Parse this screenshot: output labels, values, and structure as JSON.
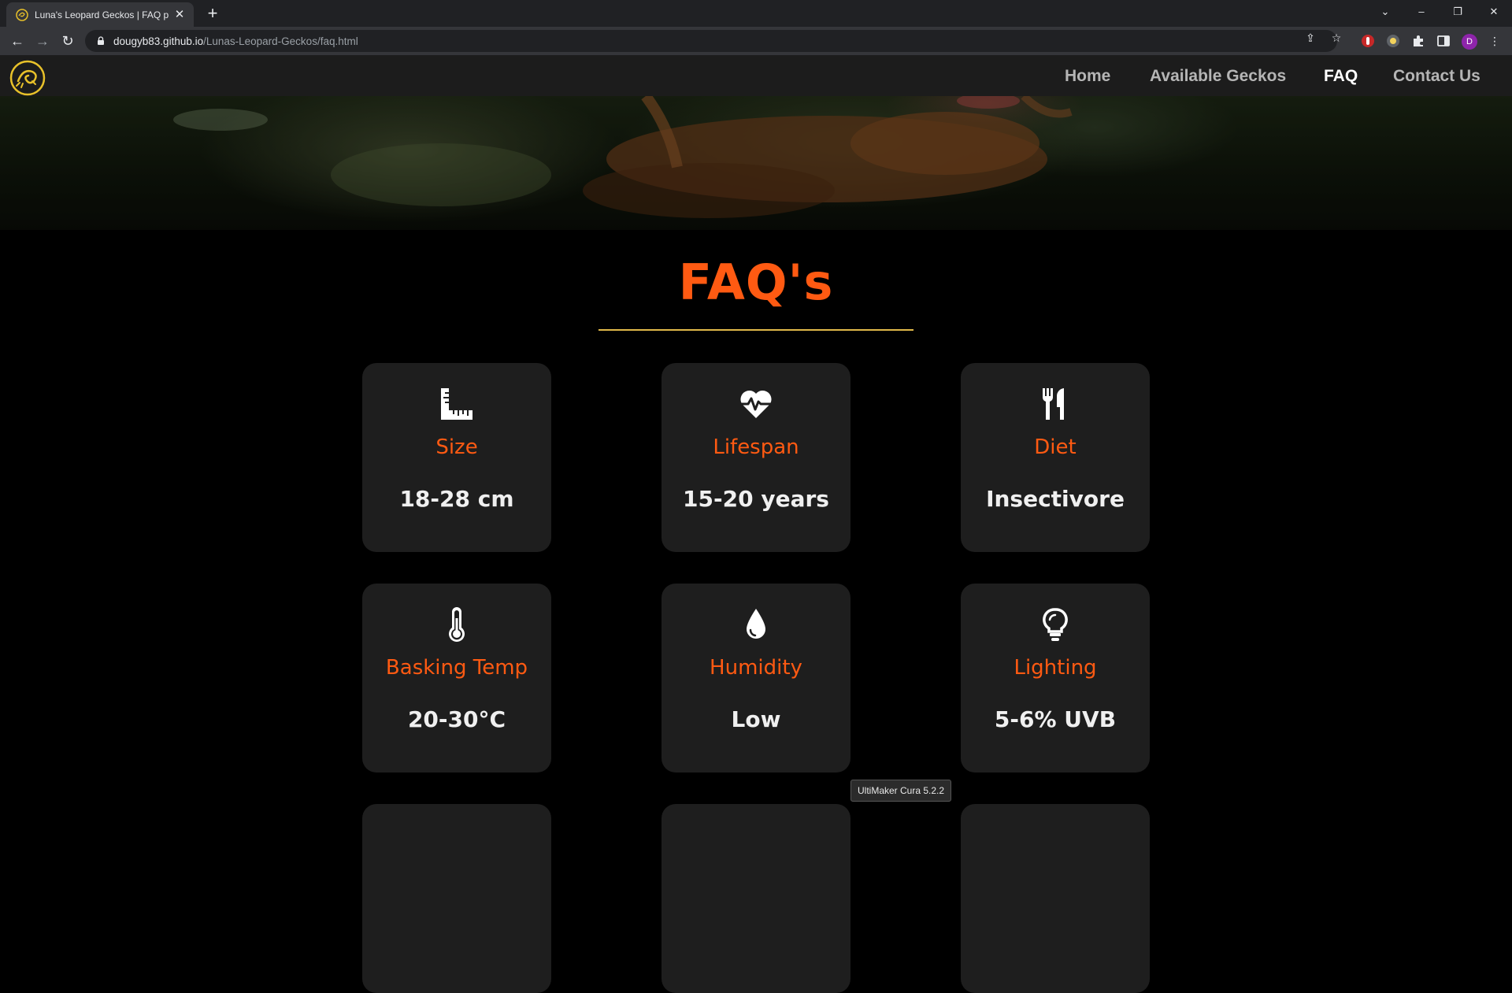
{
  "browser": {
    "tab_title": "Luna's Leopard Geckos | FAQ pag",
    "tab_close": "✕",
    "new_tab": "+",
    "url_host": "dougyb83.github.io",
    "url_path": "/Lunas-Leopard-Geckos/faq.html",
    "profile_initial": "D",
    "window_controls": {
      "dropdown": "⌄",
      "minimize": "–",
      "restore": "❐",
      "close": "✕"
    },
    "nav": {
      "back": "←",
      "forward": "→",
      "reload": "↻",
      "menu": "⋮"
    },
    "omni": {
      "share": "⇪",
      "bookmark": "☆"
    }
  },
  "site": {
    "nav": {
      "items": [
        {
          "label": "Home",
          "active": false
        },
        {
          "label": "Available Geckos",
          "active": false
        },
        {
          "label": "FAQ",
          "active": true
        },
        {
          "label": "Contact Us",
          "active": false
        }
      ]
    },
    "page_title": "FAQ's",
    "cards": [
      {
        "icon": "ruler-icon",
        "label": "Size",
        "value": "18-28 cm"
      },
      {
        "icon": "heartbeat-icon",
        "label": "Lifespan",
        "value": "15-20 years"
      },
      {
        "icon": "utensils-icon",
        "label": "Diet",
        "value": "Insectivore"
      },
      {
        "icon": "thermometer-icon",
        "label": "Basking Temp",
        "value": "20-30°C"
      },
      {
        "icon": "droplet-icon",
        "label": "Humidity",
        "value": "Low"
      },
      {
        "icon": "lightbulb-icon",
        "label": "Lighting",
        "value": "5-6% UVB"
      }
    ]
  },
  "tooltip": "UltiMaker Cura 5.2.2",
  "colors": {
    "accent": "#ff5a12",
    "rule": "#e0b94a",
    "card_bg": "#1e1e1e",
    "nav_bg": "#1c1c1c",
    "logo": "#e8c12a"
  }
}
